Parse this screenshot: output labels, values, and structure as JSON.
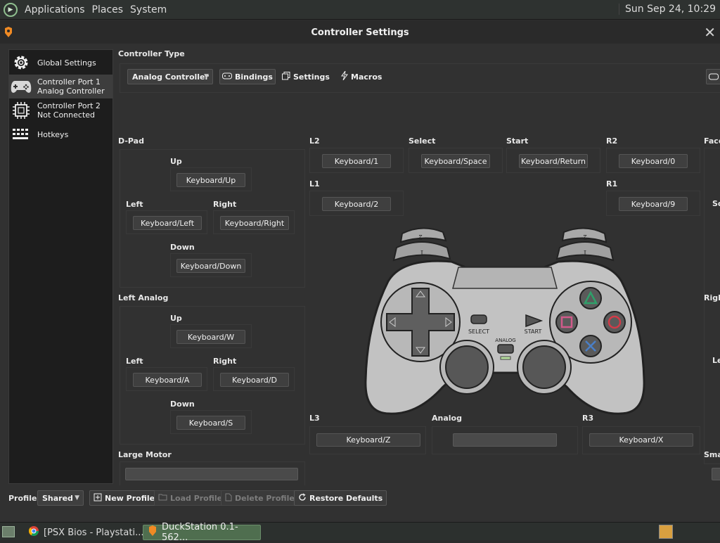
{
  "topbar": {
    "menus": [
      "Applications",
      "Places",
      "System"
    ],
    "clock": "Sun Sep 24, 10:29"
  },
  "window": {
    "title": "Controller Settings",
    "close_label": "✕"
  },
  "sidebar": {
    "items": [
      {
        "line1": "Global Settings",
        "line2": ""
      },
      {
        "line1": "Controller Port 1",
        "line2": "Analog Controller"
      },
      {
        "line1": "Controller Port 2",
        "line2": "Not Connected"
      },
      {
        "line1": "Hotkeys",
        "line2": ""
      }
    ]
  },
  "controller_type": {
    "label": "Controller Type",
    "value": "Analog Controller",
    "tabs": [
      "Bindings",
      "Settings",
      "Macros"
    ]
  },
  "dpad": {
    "label": "D-Pad",
    "up_label": "Up",
    "up": "Keyboard/Up",
    "left_label": "Left",
    "left": "Keyboard/Left",
    "right_label": "Right",
    "right": "Keyboard/Right",
    "down_label": "Down",
    "down": "Keyboard/Down"
  },
  "left_analog": {
    "label": "Left Analog",
    "up_label": "Up",
    "up": "Keyboard/W",
    "left_label": "Left",
    "left": "Keyboard/A",
    "right_label": "Right",
    "right": "Keyboard/D",
    "down_label": "Down",
    "down": "Keyboard/S"
  },
  "large_motor": {
    "label": "Large Motor"
  },
  "top_buttons": {
    "l2_label": "L2",
    "l2": "Keyboard/1",
    "select_label": "Select",
    "select": "Keyboard/Space",
    "start_label": "Start",
    "start": "Keyboard/Return",
    "r2_label": "R2",
    "r2": "Keyboard/0",
    "l1_label": "L1",
    "l1": "Keyboard/2",
    "r1_label": "R1",
    "r1": "Keyboard/9"
  },
  "bottom_buttons": {
    "l3_label": "L3",
    "l3": "Keyboard/Z",
    "analog_label": "Analog",
    "r3_label": "R3",
    "r3": "Keyboard/X"
  },
  "right_partial": {
    "face": "Face",
    "sc": "Sc",
    "righ": "Righ",
    "le": "Le",
    "sma": "Sma"
  },
  "pad_labels": {
    "select": "SELECT",
    "start": "START",
    "analog": "ANALOG",
    "l": "L",
    "r": "R",
    "l1": "1",
    "l2": "2",
    "r1": "1",
    "r2": "2"
  },
  "footer": {
    "profile_label": "Profile:",
    "profile_value": "Shared",
    "new_profile": "New Profile",
    "load_profile": "Load Profile",
    "delete_profile": "Delete Profile",
    "restore_defaults": "Restore Defaults"
  },
  "taskbar": {
    "items": [
      "[PSX Bios - Playstati...",
      "DuckStation 0.1-562..."
    ]
  },
  "colors": {
    "triangle": "#2fa06a",
    "circle": "#d23b48",
    "cross": "#4a7fc7",
    "square": "#d05a8a"
  }
}
